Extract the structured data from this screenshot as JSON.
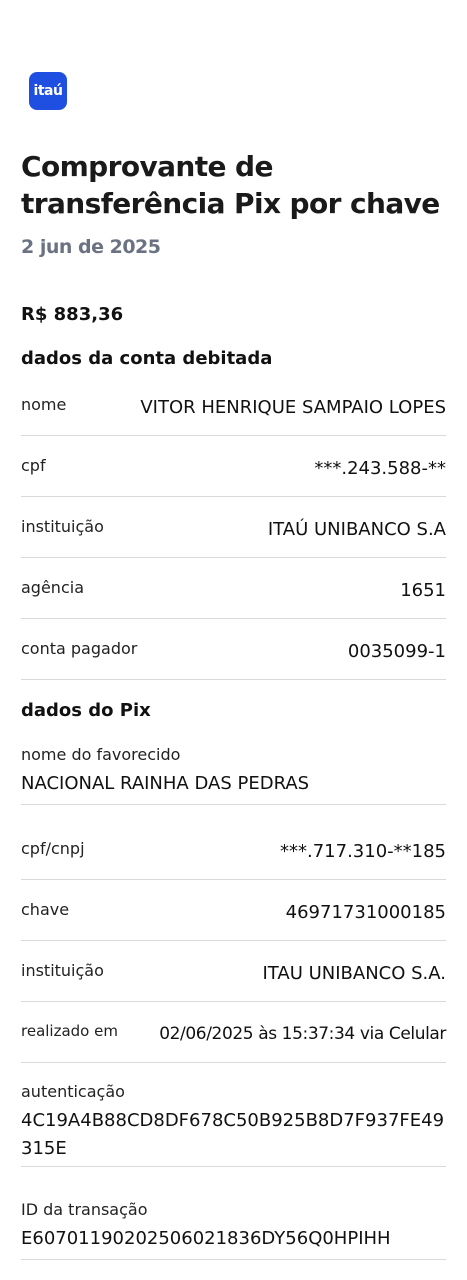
{
  "logo": {
    "text": "itaú",
    "color": "#1f4fe0"
  },
  "title": "Comprovante de transferência Pix por chave",
  "date": "2 jun de 2025",
  "amount": "R$ 883,36",
  "debit_section": {
    "heading": "dados da conta debitada",
    "rows": [
      {
        "label": "nome",
        "value": "VITOR HENRIQUE SAMPAIO LOPES"
      },
      {
        "label": "cpf",
        "value": "***.243.588-**"
      },
      {
        "label": "instituição",
        "value": "ITAÚ UNIBANCO S.A"
      },
      {
        "label": "agência",
        "value": "1651"
      },
      {
        "label": "conta pagador",
        "value": "0035099-1"
      }
    ]
  },
  "pix_section": {
    "heading": "dados do Pix",
    "favorecido": {
      "label": "nome do favorecido",
      "value": "NACIONAL RAINHA DAS PEDRAS"
    },
    "rows": [
      {
        "label": "cpf/cnpj",
        "value": "***.717.310-**185"
      },
      {
        "label": "chave",
        "value": "46971731000185"
      },
      {
        "label": "instituição",
        "value": "ITAU UNIBANCO S.A."
      },
      {
        "label": "realizado em",
        "value": "02/06/2025 às 15:37:34 via Celular"
      }
    ],
    "autenticacao": {
      "label": "autenticação",
      "value": "4C19A4B88CD8DF678C50B925B8D7F937FE49315E"
    },
    "transacao": {
      "label": "ID da transação",
      "value": "E60701190202506021836DY56Q0HPIHH"
    }
  }
}
